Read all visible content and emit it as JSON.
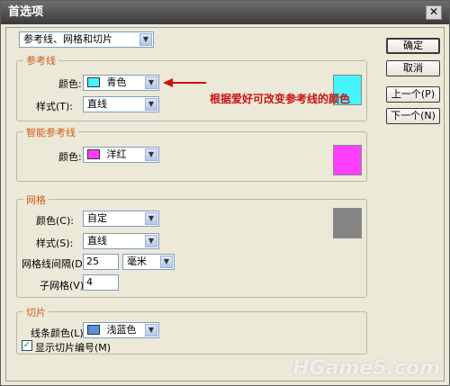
{
  "window": {
    "title": "首选项",
    "close_glyph": "✕"
  },
  "category": {
    "value": "参考线、网格和切片"
  },
  "guides": {
    "title": "参考线",
    "color_label": "颜色:",
    "color_value": "青色",
    "color_hex": "#44f4ff",
    "style_label": "样式(T):",
    "style_value": "直线"
  },
  "annotation": {
    "text": "根据爱好可改变参考线的颜色"
  },
  "smart_guides": {
    "title": "智能参考线",
    "color_label": "颜色:",
    "color_value": "洋红",
    "color_hex": "#ff3fff"
  },
  "grid": {
    "title": "网格",
    "color_label": "颜色(C):",
    "color_value": "自定",
    "color_hex": "#858585",
    "style_label": "样式(S):",
    "style_value": "直线",
    "spacing_label": "网格线间隔(D):",
    "spacing_value": "25",
    "unit_value": "毫米",
    "subdiv_label": "子网格(V):",
    "subdiv_value": "4"
  },
  "slices": {
    "title": "切片",
    "line_color_label": "线条颜色(L):",
    "line_color_value": "浅蓝色",
    "line_color_hex": "#5b8fe0",
    "show_numbers_label": "显示切片编号(M)",
    "show_numbers_checked": true
  },
  "buttons": {
    "ok": "确定",
    "cancel": "取消",
    "prev": "上一个(P)",
    "next": "下一个(N)"
  },
  "watermark": {
    "text": "HGame5.com"
  }
}
